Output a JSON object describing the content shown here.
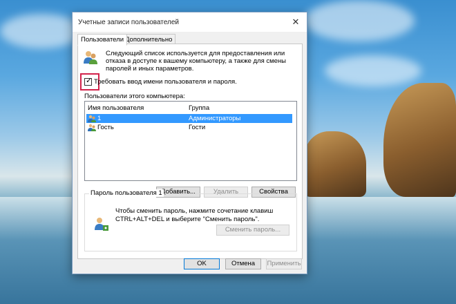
{
  "window": {
    "title": "Учетные записи пользователей",
    "close_symbol": "✕"
  },
  "tabs": [
    {
      "label": "Пользователи",
      "active": true
    },
    {
      "label": "Дополнительно",
      "active": false
    }
  ],
  "description": "Следующий список используется для предоставления или отказа в доступе к вашему компьютеру, а также для смены паролей и иных параметров.",
  "require_login": {
    "label": "Требовать ввод имени пользователя и пароля.",
    "checked": true,
    "check_symbol": "✓"
  },
  "users_list": {
    "caption": "Пользователи этого компьютера:",
    "columns": [
      "Имя пользователя",
      "Группа"
    ],
    "rows": [
      {
        "name": "1",
        "group": "Администраторы",
        "selected": true
      },
      {
        "name": "Гость",
        "group": "Гости",
        "selected": false
      }
    ]
  },
  "list_buttons": {
    "add": "Добавить...",
    "remove": "Удалить",
    "properties": "Свойства"
  },
  "password_group": {
    "title": "Пароль пользователя 1",
    "text": "Чтобы сменить пароль, нажмите сочетание клавиш CTRL+ALT+DEL и выберите \"Сменить пароль\".",
    "change_button": "Сменить пароль..."
  },
  "dialog_buttons": {
    "ok": "OK",
    "cancel": "Отмена",
    "apply": "Применить"
  },
  "colors": {
    "selection": "#3399ff",
    "highlight_frame": "#d2224a",
    "default_button_border": "#0078d7"
  },
  "icons": {
    "users": "users-icon",
    "user_row": "user-icon",
    "password": "user-key-icon"
  }
}
